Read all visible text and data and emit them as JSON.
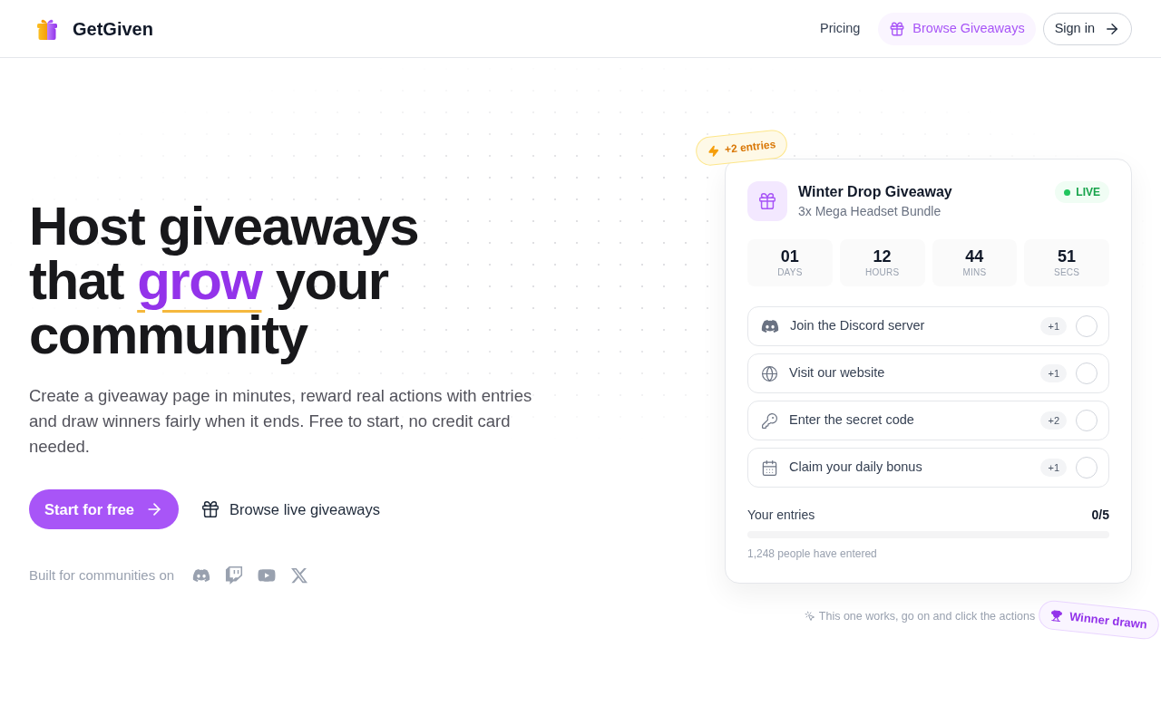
{
  "header": {
    "brand": "GetGiven",
    "nav": [
      {
        "kind": "link",
        "label": "Pricing"
      },
      {
        "kind": "accent",
        "label": "Browse Giveaways"
      },
      {
        "kind": "outline",
        "label": "Sign in"
      }
    ]
  },
  "hero": {
    "headline": {
      "before": "Host giveaways that ",
      "highlight": "grow",
      "after": " your community"
    },
    "description": "Create a giveaway page in minutes, reward real actions with entries and draw winners fairly when it ends. Free to start, no credit card needed.",
    "actions": [
      {
        "kind": "primary",
        "label": "Start for free"
      },
      {
        "kind": "secondary",
        "label": "Browse live giveaways"
      }
    ],
    "platforms_label": "Built for communities on"
  },
  "card": {
    "bonus_badge": "+2 entries",
    "title": "Winter Drop Giveaway",
    "subtitle": "3x Mega Headset Bundle",
    "status": "LIVE",
    "countdown": [
      {
        "value": "01",
        "unit": "DAYS"
      },
      {
        "value": "12",
        "unit": "HOURS"
      },
      {
        "value": "44",
        "unit": "MINS"
      },
      {
        "value": "51",
        "unit": "SECS"
      }
    ],
    "tasks": [
      {
        "label": "Join the Discord server",
        "points": "+1",
        "checked": false
      },
      {
        "label": "Visit our website",
        "points": "+1",
        "checked": false
      },
      {
        "label": "Enter the secret code",
        "points": "+2",
        "checked": false
      },
      {
        "label": "Claim your daily bonus",
        "points": "+1",
        "checked": false
      }
    ],
    "entries": {
      "label": "Your entries",
      "count": "0/5",
      "level": 0
    },
    "participants": "1,248 people have entered"
  },
  "hint": "This one works, go on and click the actions",
  "winner_badge": "Winner drawn"
}
